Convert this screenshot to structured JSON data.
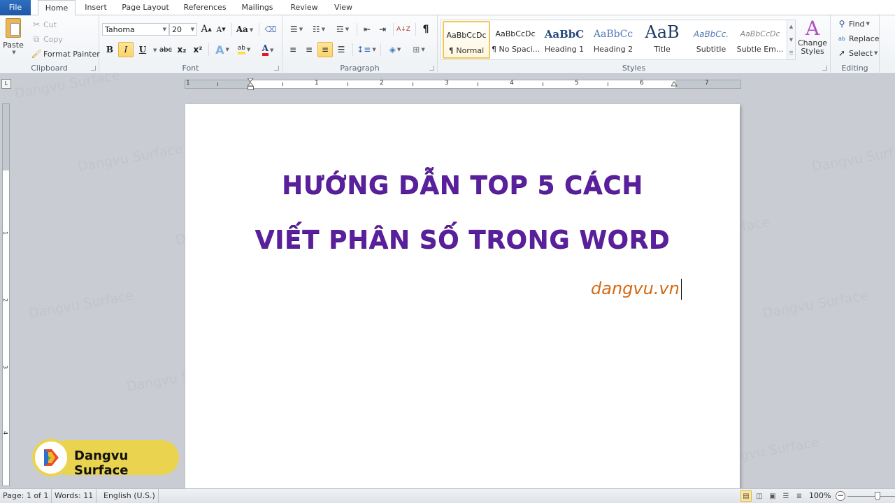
{
  "tabs": [
    "File",
    "Home",
    "Insert",
    "Page Layout",
    "References",
    "Mailings",
    "Review",
    "View"
  ],
  "active_tab": "Home",
  "clipboard": {
    "paste": "Paste",
    "cut": "Cut",
    "copy": "Copy",
    "format_painter": "Format Painter",
    "label": "Clipboard"
  },
  "font": {
    "family": "Tahoma",
    "size": "20",
    "grow": "A",
    "shrink": "A",
    "change_case": "Aa",
    "bold": "B",
    "italic": "I",
    "underline": "U",
    "strike": "abc",
    "subscript": "x₂",
    "superscript": "x²",
    "text_effects": "A",
    "highlight": "ab",
    "font_color": "A",
    "label": "Font",
    "font_color_hex": "#e31a1a",
    "highlight_hex": "#f7e14b"
  },
  "paragraph": {
    "label": "Paragraph",
    "show_marks": "¶",
    "sort": "A↓Z"
  },
  "styles": {
    "label": "Styles",
    "items": [
      {
        "preview": "AaBbCcDc",
        "name": "¶ Normal"
      },
      {
        "preview": "AaBbCcDc",
        "name": "¶ No Spaci..."
      },
      {
        "preview": "AaBbC",
        "name": "Heading 1"
      },
      {
        "preview": "AaBbCc",
        "name": "Heading 2"
      },
      {
        "preview": "AaB",
        "name": "Title"
      },
      {
        "preview": "AaBbCc.",
        "name": "Subtitle"
      },
      {
        "preview": "AaBbCcDc",
        "name": "Subtle Em..."
      }
    ],
    "change_styles": "Change Styles"
  },
  "editing": {
    "label": "Editing",
    "find": "Find",
    "replace": "Replace",
    "select": "Select"
  },
  "ruler": {
    "h_numbers": [
      "1",
      "1",
      "2",
      "3",
      "4",
      "5",
      "6",
      "7"
    ],
    "v_numbers": [
      "1",
      "2",
      "3",
      "4"
    ]
  },
  "document": {
    "title_line1": "HƯỚNG DẪN TOP 5 CÁCH",
    "title_line2": "VIẾT PHÂN SỐ TRONG WORD",
    "site": "dangvu.vn",
    "title_color": "#5a1f9c",
    "site_color": "#d46a14"
  },
  "watermark": "Dangvu Surface",
  "badge": {
    "text": "Dangvu Surface",
    "color": "#ead44f"
  },
  "status": {
    "page": "Page: 1 of 1",
    "words": "Words: 11",
    "language": "English (U.S.)",
    "zoom": "100%"
  }
}
